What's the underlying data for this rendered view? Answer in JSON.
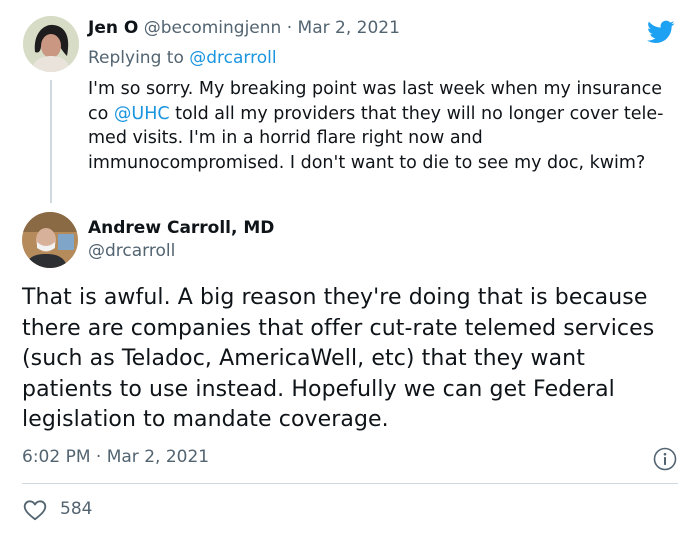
{
  "reply_tweet": {
    "author_name": "Jen O",
    "handle": "@becomingjenn",
    "separator": "·",
    "date": "Mar 2, 2021",
    "replying_to_prefix": "Replying to",
    "replying_to_handle": "@drcarroll",
    "text_before_mention": "I'm so sorry. My breaking point was last week when my insurance co ",
    "mention": "@UHC",
    "text_after_mention": " told all my providers that they will no longer cover tele-med visits. I'm in a horrid flare right now and immunocompromised. I don't want to die to see my doc, kwim?"
  },
  "main_tweet": {
    "author_name": "Andrew Carroll, MD",
    "handle": "@drcarroll",
    "text": "That is awful. A big reason they're doing that is because there are companies that offer cut-rate telemed services (such as Teladoc, AmericaWell, etc) that they want patients to use instead. Hopefully we can get Federal legislation to mandate coverage.",
    "time": "6:02 PM",
    "separator": "·",
    "date": "Mar 2, 2021",
    "likes_count": "584"
  },
  "icons": {
    "brand": "twitter-bird-icon",
    "info": "info-icon",
    "like": "heart-icon"
  },
  "colors": {
    "brand_blue": "#1da1f2",
    "link_blue": "#1b95e0",
    "muted": "#536471",
    "thread_line": "#cfd9de"
  }
}
